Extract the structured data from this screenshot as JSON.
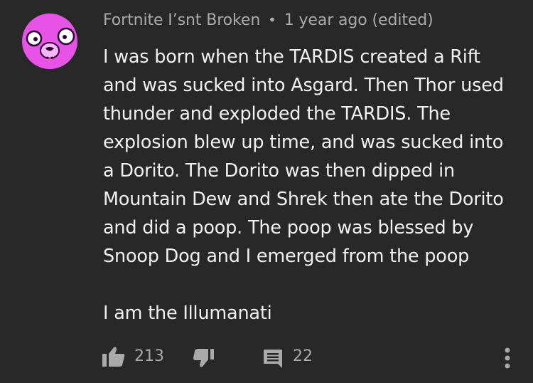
{
  "comment": {
    "author": "Fortnite I’snt Broken",
    "separator": "•",
    "timestamp": "1 year ago (edited)",
    "paragraphs": [
      "I was born when the TARDIS created a Rift\nand was sucked into Asgard. Then Thor used\nthunder and exploded the TARDIS. The\nexplosion blew up time, and was sucked into\na Dorito. The Dorito was then dipped in\nMountain Dew and Shrek then ate the Dorito\nand did a poop. The poop was blessed by\nSnoop Dog and I emerged from the poop",
      "I am the Illumanati"
    ],
    "avatar_icon": "pink-llama-face-icon",
    "avatar_color": "#e653e6"
  },
  "actions": {
    "like_icon": "thumbs-up-icon",
    "like_count": "213",
    "dislike_icon": "thumbs-down-icon",
    "reply_icon": "reply-comment-icon",
    "reply_count": "22",
    "more_icon": "vertical-dots-icon"
  },
  "colors": {
    "background": "#282828",
    "primary_text": "#f1f1f1",
    "secondary_text": "#aaaaaa"
  }
}
